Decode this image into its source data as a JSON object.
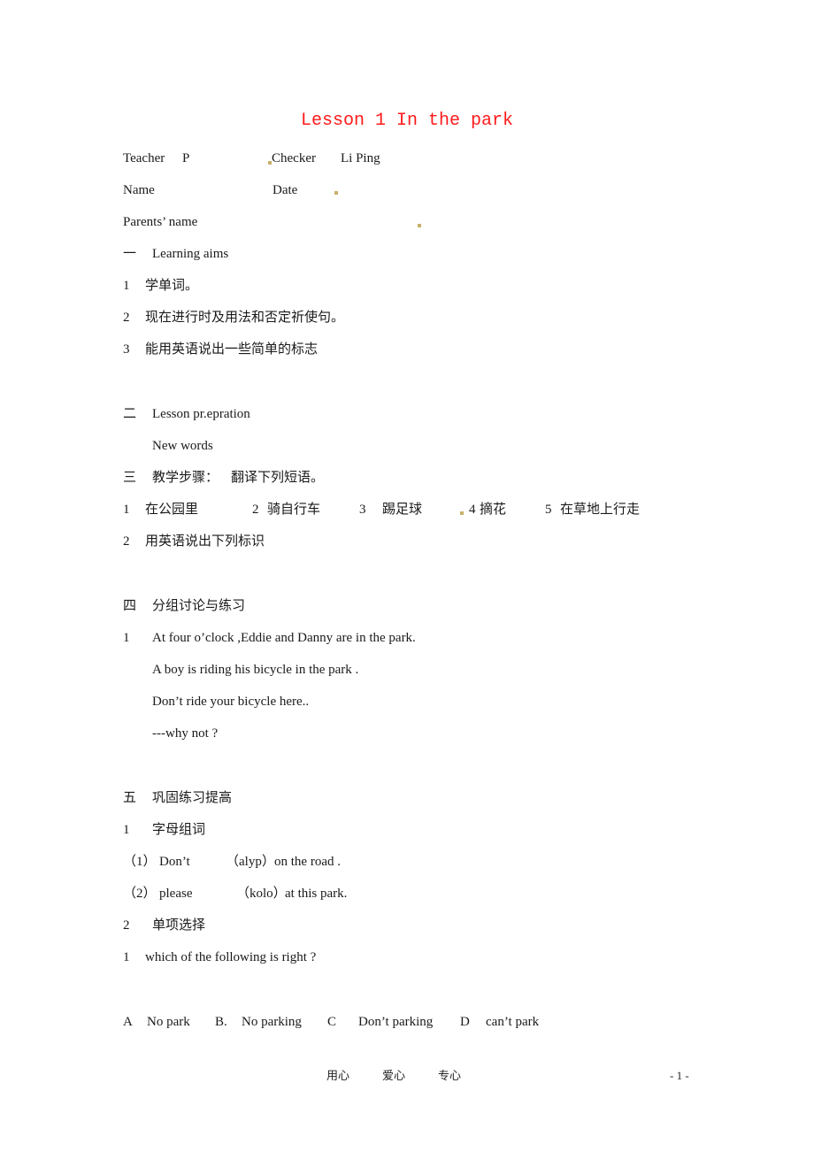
{
  "title": "Lesson 1 In the park",
  "header": {
    "teacher_label": "Teacher",
    "teacher_value": "P",
    "checker_label": "Checker",
    "checker_value": "Li Ping",
    "name_label": "Name",
    "date_label": "Date",
    "parents_label": "Parents’ name"
  },
  "section1": {
    "marker": "一",
    "heading": "Learning aims",
    "items": [
      {
        "num": "1",
        "text": "学单词。"
      },
      {
        "num": "2",
        "text": "现在进行时及用法和否定祈使句。"
      },
      {
        "num": "3",
        "text": "能用英语说出一些简单的标志"
      }
    ]
  },
  "section2": {
    "marker": "二",
    "heading": "Lesson pr.epration",
    "sub": "New words"
  },
  "section3": {
    "marker": "三",
    "heading": "教学步骤：",
    "instruction": "翻译下列短语。",
    "phrases": [
      {
        "num": "1",
        "text": "在公园里"
      },
      {
        "num": "2",
        "text": "骑自行车"
      },
      {
        "num": "3",
        "text": "踢足球"
      },
      {
        "num": "4",
        "text": "摘花"
      },
      {
        "num": "5",
        "text": "在草地上行走"
      }
    ],
    "item2_num": "2",
    "item2_text": "用英语说出下列标识"
  },
  "section4": {
    "marker": "四",
    "heading": "分组讨论与练习",
    "num": "1",
    "lines": [
      "At four o’clock ,Eddie and Danny are in the park.",
      "A boy is riding his bicycle in the park .",
      "Don’t ride your bicycle here..",
      "---why not ?"
    ]
  },
  "section5": {
    "marker": "五",
    "heading": "巩固练习提高",
    "part1_num": "1",
    "part1_heading": "字母组词",
    "part1_items": [
      {
        "num": "（1）",
        "before": "Don’t",
        "clue": "（alyp）",
        "after": "on the road ."
      },
      {
        "num": "（2）",
        "before": "please",
        "clue": "（kolo）",
        "after": "at this park."
      }
    ],
    "part2_num": "2",
    "part2_heading": "单项选择",
    "question_num": "1",
    "question": "which of the following is right ?",
    "options": [
      {
        "letter": "A",
        "text": "No park"
      },
      {
        "letter": "B.",
        "text": "No parking"
      },
      {
        "letter": "C",
        "text": "Don’t parking"
      },
      {
        "letter": "D",
        "text": "can’t park"
      }
    ]
  },
  "footer": {
    "mottos": [
      "用心",
      "爱心",
      "专心"
    ],
    "page_number": "- 1 -"
  },
  "colors": {
    "title": "#ff1a1a",
    "text": "#1a1a1a",
    "marker_dots": "#c8b06a"
  }
}
